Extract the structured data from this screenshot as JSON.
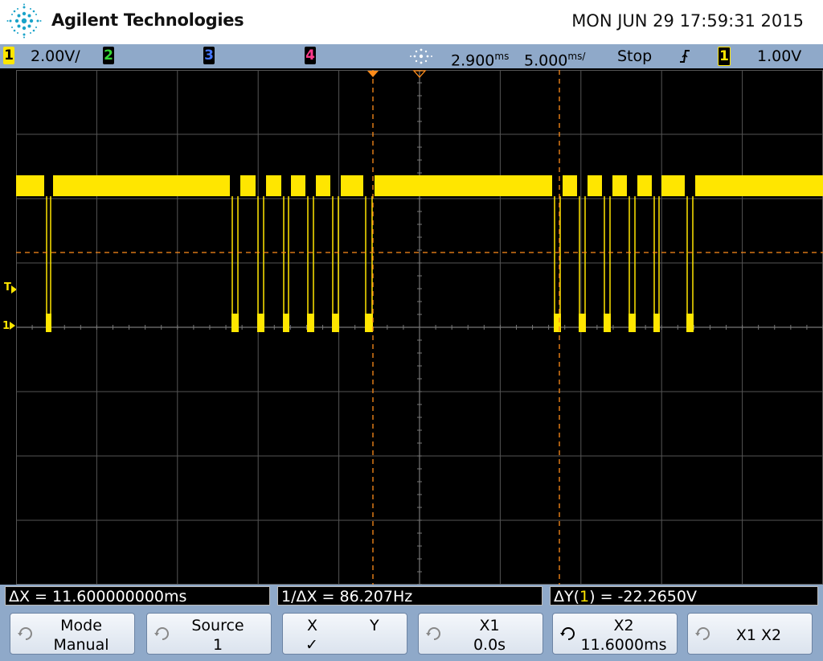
{
  "header": {
    "brand": "Agilent Technologies",
    "datetime": "MON JUN 29 17:59:31 2015"
  },
  "status": {
    "ch1_num": "1",
    "ch1_scale": "2.00V/",
    "ch2_num": "2",
    "ch3_num": "3",
    "ch4_num": "4",
    "time_delay": "2.900",
    "time_delay_unit": "ms",
    "time_scale": "5.000",
    "time_scale_unit": "ms/",
    "run_state": "Stop",
    "trigger_source": "1",
    "trigger_level": "1.00V",
    "colors": {
      "ch1": "#ffe600",
      "ch2": "#33d633",
      "ch3": "#4477ff",
      "ch4": "#ff3a8c"
    }
  },
  "screen": {
    "trigger_marker": "T",
    "ch1_marker": "1",
    "trace_color": "#ffe600",
    "cursor_color": "#ff8c1a",
    "grid_color": "#555555"
  },
  "readouts": {
    "delta_x": "ΔX = 11.600000000ms",
    "inv_delta_x": "1/ΔX = 86.207Hz",
    "delta_y_prefix": "ΔY(",
    "delta_y_channel": "1",
    "delta_y_suffix": ") = -22.2650V"
  },
  "softkeys": [
    {
      "top": "Mode",
      "bottom": "Manual"
    },
    {
      "top": "Source",
      "bottom": "1"
    },
    {
      "top": "X",
      "top2": "Y",
      "bottom": "✓"
    },
    {
      "top": "X1",
      "bottom": "0.0s"
    },
    {
      "top": "X2",
      "bottom": "11.6000ms"
    },
    {
      "top": "X1 X2",
      "bottom": ""
    }
  ]
}
